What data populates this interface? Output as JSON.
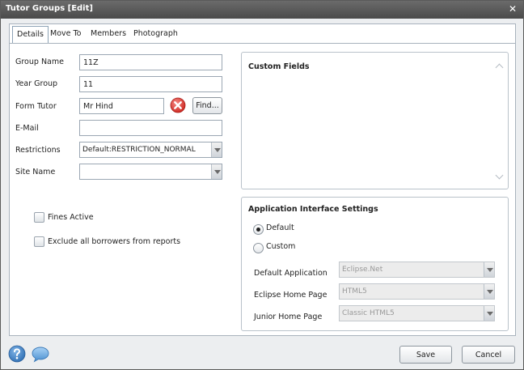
{
  "window": {
    "title": "Tutor Groups [Edit]",
    "close_glyph": "✕"
  },
  "tabs": [
    {
      "label": "Details",
      "active": true
    },
    {
      "label": "Move To"
    },
    {
      "label": "Members"
    },
    {
      "label": "Photograph"
    }
  ],
  "form": {
    "group_name": {
      "label": "Group Name",
      "value": "11Z"
    },
    "year_group": {
      "label": "Year Group",
      "value": "11"
    },
    "form_tutor": {
      "label": "Form Tutor",
      "value": "Mr Hind",
      "find_label": "Find..."
    },
    "email": {
      "label": "E-Mail",
      "value": ""
    },
    "restrictions": {
      "label": "Restrictions",
      "value": "Default:RESTRICTION_NORMAL"
    },
    "site_name": {
      "label": "Site Name",
      "value": ""
    }
  },
  "checkboxes": {
    "fines_active": {
      "label": "Fines Active",
      "checked": false
    },
    "exclude_borrowers": {
      "label": "Exclude all borrowers from reports",
      "checked": false
    }
  },
  "custom_fields": {
    "title": "Custom Fields"
  },
  "app_settings": {
    "title": "Application Interface Settings",
    "radio_default": {
      "label": "Default",
      "checked": true
    },
    "radio_custom": {
      "label": "Custom",
      "checked": false
    },
    "default_application": {
      "label": "Default Application",
      "value": "Eclipse.Net"
    },
    "eclipse_home_page": {
      "label": "Eclipse Home Page",
      "value": "HTML5"
    },
    "junior_home_page": {
      "label": "Junior Home Page",
      "value": "Classic HTML5"
    }
  },
  "footer": {
    "save_label": "Save",
    "cancel_label": "Cancel"
  },
  "icons": {
    "help": "help-icon",
    "chat": "chat-icon",
    "clear": "clear-icon"
  },
  "colors": {
    "title_bar": "#555555",
    "clear_icon": "#e0413a",
    "help_icon": "#3d83c8"
  }
}
